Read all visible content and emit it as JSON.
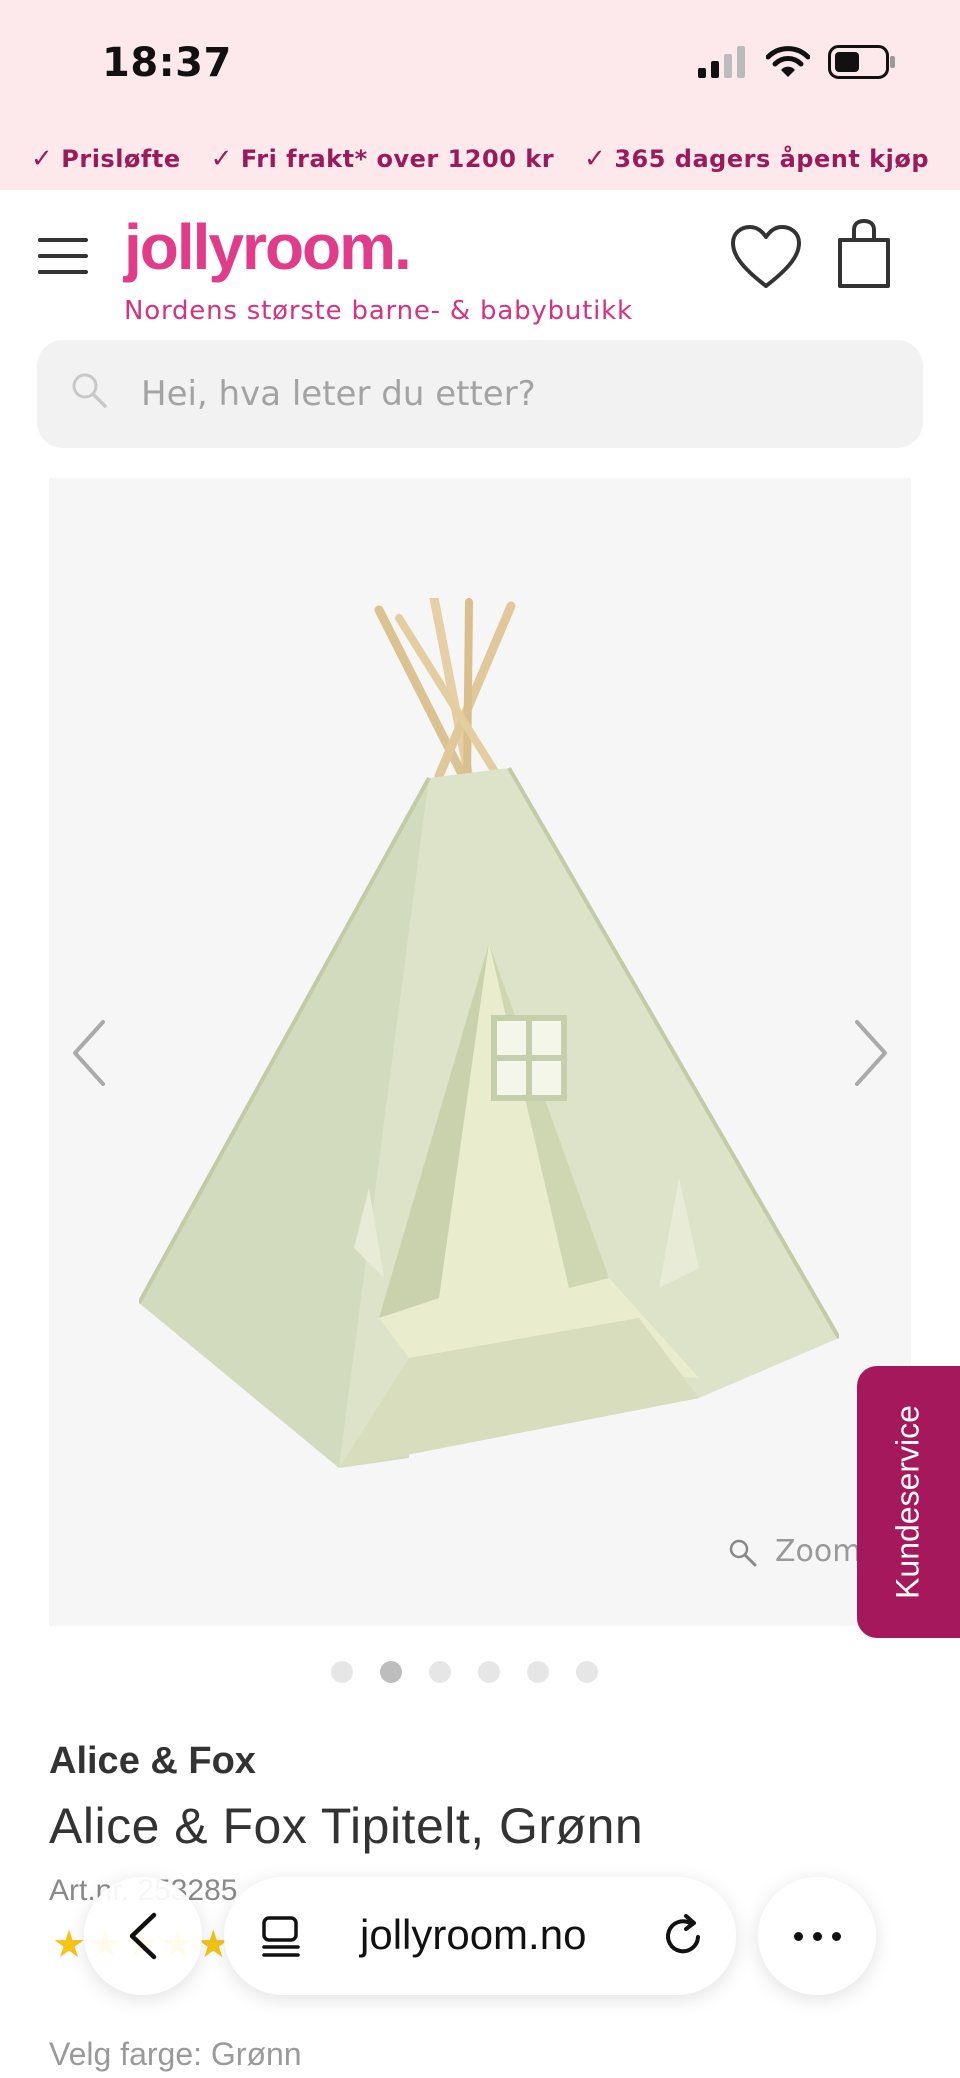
{
  "status_bar": {
    "time": "18:37"
  },
  "usp": [
    {
      "label": "Prisløfte"
    },
    {
      "label": "Fri frakt* over 1200 kr"
    },
    {
      "label": "365 dagers åpent kjøp"
    }
  ],
  "header": {
    "logo": "jollyroom.",
    "tagline": "Nordens største barne- & babybutikk",
    "icons": {
      "menu": "hamburger-icon",
      "wishlist": "heart-icon",
      "cart": "shopping-bag-icon"
    }
  },
  "search": {
    "placeholder": "Hei, hva leter du etter?",
    "value": ""
  },
  "gallery": {
    "zoom_label": "Zoom",
    "image_count": 6,
    "active_index": 1
  },
  "side_tab": {
    "label": "Kundeservice"
  },
  "product": {
    "brand": "Alice & Fox",
    "title": "Alice & Fox Tipitelt, Grønn",
    "article": "Art.nr. 253285",
    "rating_stars": 5,
    "color_label": "Velg farge: Grønn"
  },
  "browser": {
    "url": "jollyroom.no"
  },
  "colors": {
    "brand_pink": "#e23b8a",
    "usp_text": "#9b1b5a",
    "banner_bg": "#fde9ec",
    "side_tab_bg": "#a5185b",
    "star": "#f5c518"
  }
}
